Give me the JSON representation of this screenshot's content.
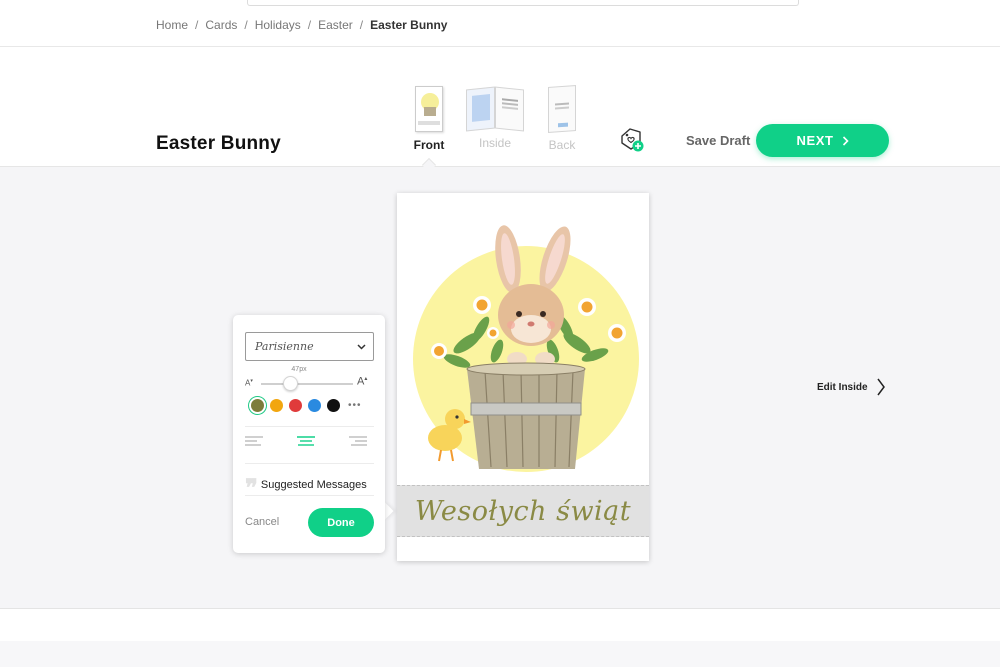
{
  "breadcrumb": [
    "Home",
    "Cards",
    "Holidays",
    "Easter",
    "Easter Bunny"
  ],
  "breadcrumb_separator": "/",
  "header": {
    "title": "Easter Bunny",
    "tabs": [
      {
        "label": "Front",
        "active": true
      },
      {
        "label": "Inside",
        "active": false
      },
      {
        "label": "Back",
        "active": false
      }
    ],
    "save_draft_label": "Save Draft",
    "next_label": "NEXT",
    "next_icon": "chevron-right-icon",
    "favorite_icon": "heart-tag-add-icon"
  },
  "card": {
    "message": "Wesołych świąt",
    "message_color": "#8a8a45",
    "sun_color": "#fbf4a0"
  },
  "edit_inside_label": "Edit Inside",
  "text_panel": {
    "font_name": "Parisienne",
    "font_size_label": "47px",
    "size_min_label": "A",
    "size_max_label": "A",
    "size_fraction": 0.32,
    "colors": [
      {
        "name": "olive",
        "hex": "#7d7c3a",
        "selected": true
      },
      {
        "name": "orange",
        "hex": "#f2a60f",
        "selected": false
      },
      {
        "name": "red",
        "hex": "#e03b3b",
        "selected": false
      },
      {
        "name": "blue",
        "hex": "#2a8ae0",
        "selected": false
      },
      {
        "name": "black",
        "hex": "#111111",
        "selected": false
      }
    ],
    "more_colors": "•••",
    "alignment": "center",
    "suggested_label": "Suggested Messages",
    "cancel_label": "Cancel",
    "done_label": "Done"
  },
  "accent_color": "#10d088"
}
